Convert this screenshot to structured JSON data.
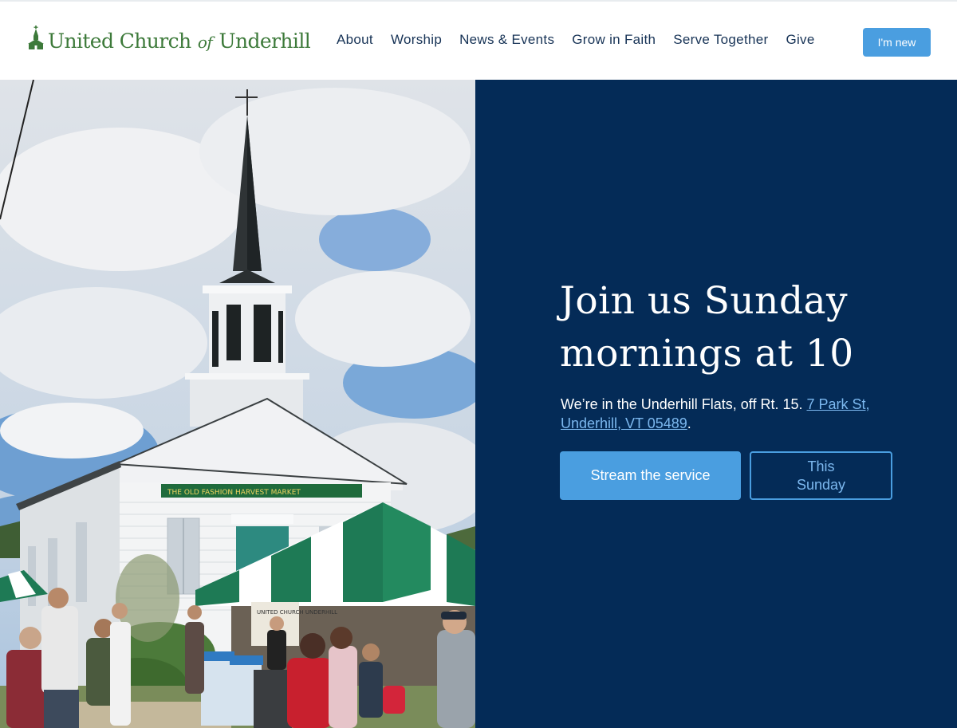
{
  "logo": {
    "text_before": "United Church",
    "text_of": "of",
    "text_after": "Underhill",
    "color": "#3d7a3a",
    "icon": "church-steeple-icon"
  },
  "nav": {
    "items": [
      {
        "label": "About"
      },
      {
        "label": "Worship"
      },
      {
        "label": "News & Events"
      },
      {
        "label": "Grow in Faith"
      },
      {
        "label": "Serve Together"
      },
      {
        "label": "Give"
      }
    ],
    "cta_label": "I'm new"
  },
  "hero": {
    "title": "Join us Sunday mornings at 10",
    "desc_text": "We’re in the Underhill Flats, off Rt. 15. ",
    "address_link": "7 Park St, Underhill, VT 05489",
    "desc_end": ".",
    "stream_button": "Stream the service",
    "sunday_button": "This Sunday",
    "image": {
      "sign_text": "THE OLD FASHION  HARVEST MARKET",
      "tent_sign": "UNITED CHURCH UNDERHILL"
    }
  },
  "colors": {
    "panel_bg": "#042b57",
    "accent": "#4a9ee0",
    "link": "#7cb8ef",
    "nav_text": "#173356"
  }
}
